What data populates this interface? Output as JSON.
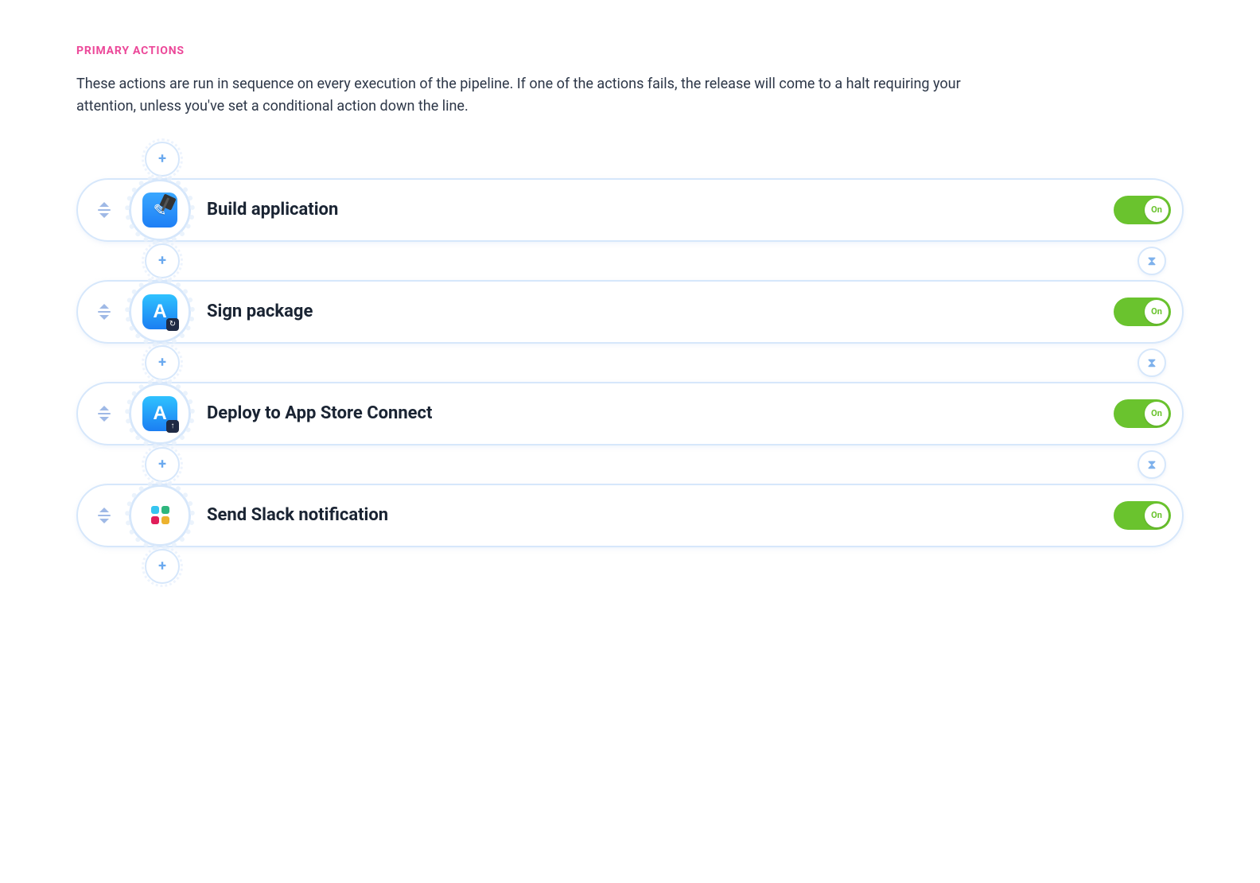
{
  "section": {
    "heading": "PRIMARY ACTIONS",
    "description": "These actions are run in sequence on every execution of the pipeline. If one of the actions fails, the release will come to a halt requiring your attention, unless you've set a conditional action down the line."
  },
  "actions": [
    {
      "title": "Build application",
      "icon": "xcode-hammer",
      "toggle": {
        "state": "on",
        "label": "On"
      }
    },
    {
      "title": "Sign package",
      "icon": "appstore-sign",
      "toggle": {
        "state": "on",
        "label": "On"
      }
    },
    {
      "title": "Deploy to App Store Connect",
      "icon": "appstore-upload",
      "toggle": {
        "state": "on",
        "label": "On"
      }
    },
    {
      "title": "Send Slack notification",
      "icon": "slack",
      "toggle": {
        "state": "on",
        "label": "On"
      }
    }
  ],
  "icons": {
    "plus": "+",
    "hourglass": "⧗",
    "sign_badge": "↻",
    "upload_badge": "↑"
  }
}
